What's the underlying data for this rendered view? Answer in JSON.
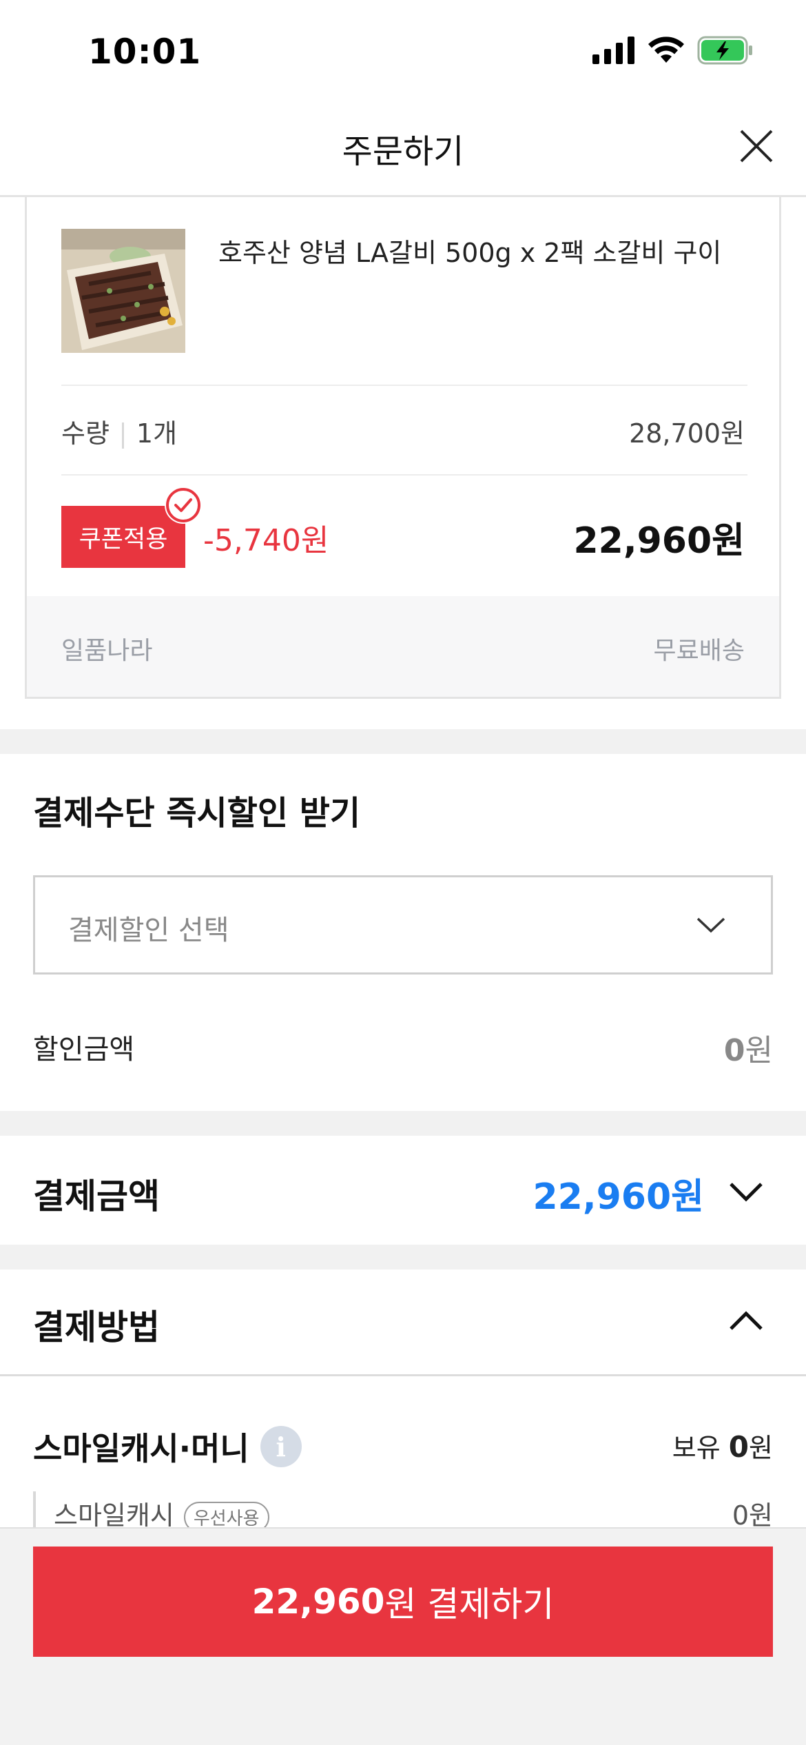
{
  "status_bar": {
    "time": "10:01"
  },
  "header": {
    "title": "주문하기"
  },
  "product": {
    "name": "호주산 양념 LA갈비 500g x 2팩 소갈비 구이",
    "quantity_label": "수량",
    "quantity_value": "1개",
    "unit_price": "28,700원",
    "coupon_label": "쿠폰적용",
    "discount": "-5,740원",
    "final_price": "22,960원",
    "seller": "일품나라",
    "shipping": "무료배송"
  },
  "instant_discount": {
    "title": "결제수단 즉시할인 받기",
    "dropdown_value": "결제할인 선택",
    "amount_label": "할인금액",
    "amount_value": "0",
    "amount_unit": "원"
  },
  "payment_amount": {
    "label": "결제금액",
    "value": "22,960원"
  },
  "payment_method": {
    "label": "결제방법",
    "smile_title": "스마일캐시·머니",
    "info_glyph": "i",
    "holdings_prefix": "보유",
    "holdings_value": "0",
    "holdings_unit": "원",
    "smilecash_label": "스마일캐시",
    "priority_badge": "우선사용",
    "smilecash_value": "0원"
  },
  "bottom": {
    "pay_amount": "22,960",
    "pay_suffix": "원 결제하기"
  },
  "colors": {
    "accent_red": "#e8353f",
    "accent_blue": "#1a7df1",
    "battery_green": "#34c759"
  },
  "icons": {
    "signal": "cellular-signal-icon",
    "wifi": "wifi-icon",
    "battery": "battery-charging-icon",
    "close": "close-icon",
    "check": "check-circle-icon",
    "chevron_down": "chevron-down-icon",
    "chevron_up": "chevron-up-icon",
    "info": "info-icon"
  }
}
